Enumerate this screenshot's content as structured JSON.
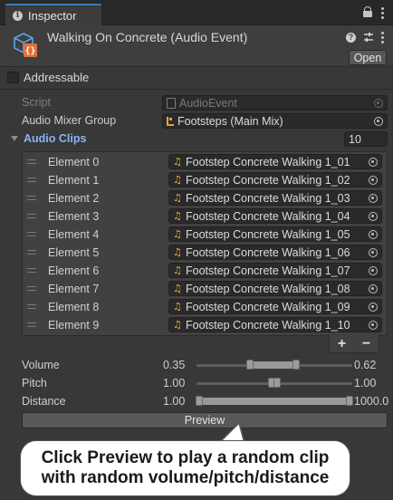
{
  "tab": {
    "label": "Inspector"
  },
  "header": {
    "title": "Walking On Concrete (Audio Event)",
    "open_label": "Open"
  },
  "addressable": {
    "label": "Addressable",
    "checked": false
  },
  "script": {
    "label": "Script",
    "value": "AudioEvent"
  },
  "mixer": {
    "label": "Audio Mixer Group",
    "value": "Footsteps (Main Mix)"
  },
  "clips": {
    "label": "Audio Clips",
    "count": "10",
    "items": [
      {
        "label": "Element 0",
        "value": "Footstep Concrete Walking 1_01"
      },
      {
        "label": "Element 1",
        "value": "Footstep Concrete Walking 1_02"
      },
      {
        "label": "Element 2",
        "value": "Footstep Concrete Walking 1_03"
      },
      {
        "label": "Element 3",
        "value": "Footstep Concrete Walking 1_04"
      },
      {
        "label": "Element 4",
        "value": "Footstep Concrete Walking 1_05"
      },
      {
        "label": "Element 5",
        "value": "Footstep Concrete Walking 1_06"
      },
      {
        "label": "Element 6",
        "value": "Footstep Concrete Walking 1_07"
      },
      {
        "label": "Element 7",
        "value": "Footstep Concrete Walking 1_08"
      },
      {
        "label": "Element 8",
        "value": "Footstep Concrete Walking 1_09"
      },
      {
        "label": "Element 9",
        "value": "Footstep Concrete Walking 1_10"
      }
    ],
    "add_label": "+",
    "remove_label": "−"
  },
  "volume": {
    "label": "Volume",
    "min": "0.35",
    "max": "0.62"
  },
  "pitch": {
    "label": "Pitch",
    "min": "1.00",
    "max": "1.00"
  },
  "distance": {
    "label": "Distance",
    "min": "1.00",
    "max": "1000.0"
  },
  "preview": {
    "label": "Preview"
  },
  "callout": {
    "line1": "Click Preview to play a random clip",
    "line2": "with random volume/pitch/distance"
  },
  "colors": {
    "accent_tab": "#3a79bb",
    "foldout_label": "#8db3f0",
    "audio_clip_icon": "#f0b43a",
    "mixer_icon": "#e8a23a"
  }
}
